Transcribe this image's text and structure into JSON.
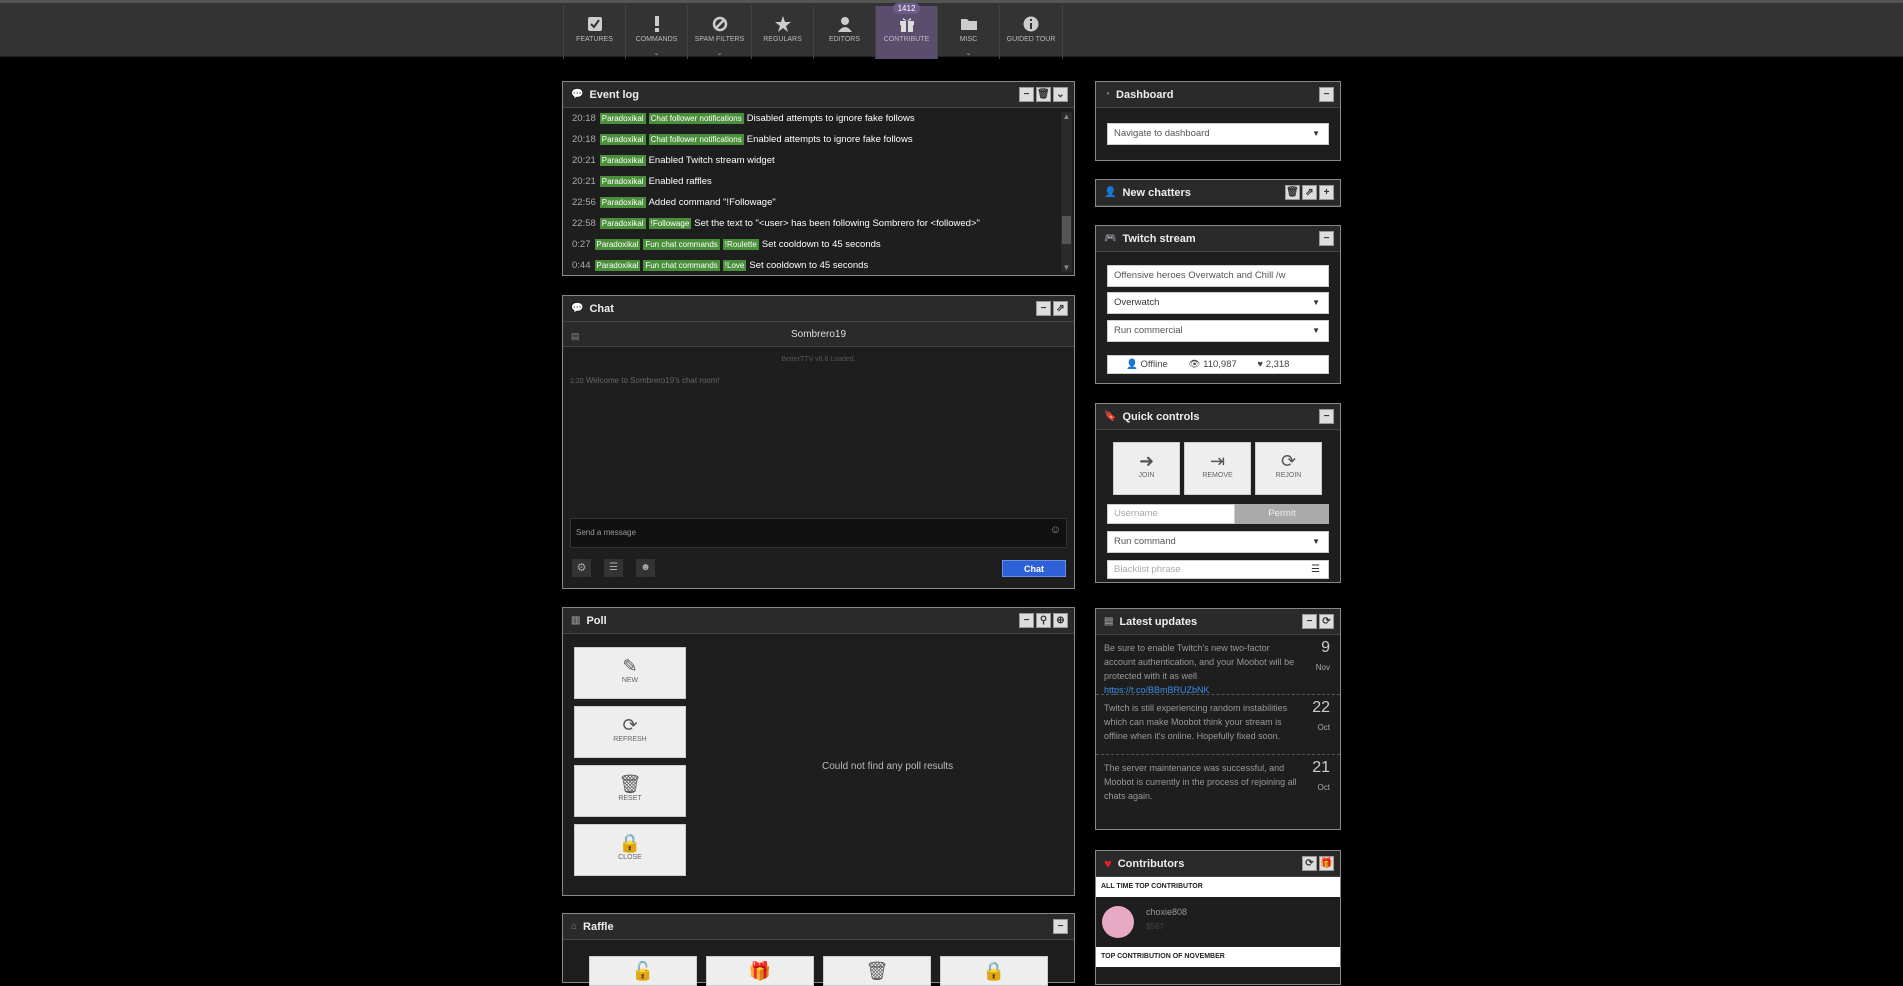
{
  "nav": {
    "badge": "1412",
    "items": [
      {
        "label": "FEATURES",
        "icon": "checkbox-icon"
      },
      {
        "label": "COMMANDS",
        "icon": "exclamation-icon"
      },
      {
        "label": "SPAM FILTERS",
        "icon": "ban-icon"
      },
      {
        "label": "REGULARS",
        "icon": "star-icon"
      },
      {
        "label": "EDITORS",
        "icon": "user-icon"
      },
      {
        "label": "CONTRIBUTE",
        "icon": "gift-icon"
      },
      {
        "label": "MISC",
        "icon": "folder-icon"
      },
      {
        "label": "GUIDED TOUR",
        "icon": "info-icon"
      }
    ]
  },
  "eventlog": {
    "title": "Event log",
    "rows": [
      {
        "time": "20:18",
        "tags": [
          "Paradoxikal",
          "Chat follower notifications"
        ],
        "text": "Disabled attempts to ignore fake follows"
      },
      {
        "time": "20:18",
        "tags": [
          "Paradoxikal",
          "Chat follower notifications"
        ],
        "text": "Enabled attempts to ignore fake follows"
      },
      {
        "time": "20:21",
        "tags": [
          "Paradoxikal"
        ],
        "text": "Enabled Twitch stream widget"
      },
      {
        "time": "20:21",
        "tags": [
          "Paradoxikal"
        ],
        "text": "Enabled raffles"
      },
      {
        "time": "22:56",
        "tags": [
          "Paradoxikal"
        ],
        "text": "Added command \"!Followage\""
      },
      {
        "time": "22:58",
        "tags": [
          "Paradoxikal",
          "!Followage"
        ],
        "text": "Set the text to \"<user> has been following Sombrero for <followed>\""
      },
      {
        "time": "0:27",
        "tags": [
          "Paradoxikal",
          "Fun chat commands",
          "!Roulette"
        ],
        "text": "Set cooldown to 45 seconds"
      },
      {
        "time": "0:44",
        "tags": [
          "Paradoxikal",
          "Fun chat commands",
          "!Love"
        ],
        "text": "Set cooldown to 45 seconds"
      }
    ]
  },
  "chat": {
    "title": "Chat",
    "channel": "Sombrero19",
    "loaded": "BetterTTV v6.8 Loaded.",
    "welcome_time": "1:20",
    "welcome": "Welcome to Sombrero19's chat room!",
    "placeholder": "Send a message",
    "send_label": "Chat"
  },
  "poll": {
    "title": "Poll",
    "buttons": [
      "NEW",
      "REFRESH",
      "RESET",
      "CLOSE"
    ],
    "empty": "Could not find any poll results"
  },
  "raffle": {
    "title": "Raffle"
  },
  "dashboard": {
    "title": "Dashboard",
    "select": "Navigate to dashboard"
  },
  "newchatters": {
    "title": "New chatters"
  },
  "twitch": {
    "title": "Twitch stream",
    "stream_title": "Offensive heroes Overwatch and Chill /w",
    "game": "Overwatch",
    "commercial": "Run commercial",
    "status": "Offline",
    "viewers": "110,987",
    "followers": "2,318"
  },
  "quick": {
    "title": "Quick controls",
    "buttons": [
      "JOIN",
      "REMOVE",
      "REJOIN"
    ],
    "username_placeholder": "Username",
    "permit": "Permit",
    "run_command": "Run command",
    "blacklist_placeholder": "Blacklist phrase"
  },
  "updates": {
    "title": "Latest updates",
    "items": [
      {
        "text": "Be sure to enable Twitch's new two-factor account authentication, and your Moobot will be protected with it as well",
        "link": "https://t.co/BBmBRUZbNK",
        "day": "9",
        "month": "Nov"
      },
      {
        "text": "Twitch is still experiencing random instabilities which can make Moobot think your stream is offline when it's online. Hopefully fixed soon.",
        "link": "",
        "day": "22",
        "month": "Oct"
      },
      {
        "text": "The server maintenance was successful, and Moobot is currently in the process of rejoining all chats again.",
        "link": "",
        "day": "21",
        "month": "Oct"
      }
    ]
  },
  "contributors": {
    "title": "Contributors",
    "all_time_label": "ALL TIME TOP CONTRIBUTOR",
    "all_time_name": "choxie808",
    "all_time_amount": "$587",
    "month_label": "TOP CONTRIBUTION OF NOVEMBER"
  },
  "colors": {
    "accent": "#5b4d6e",
    "tag_green": "#4a8f3a",
    "chat_button": "#2d5fd6"
  }
}
